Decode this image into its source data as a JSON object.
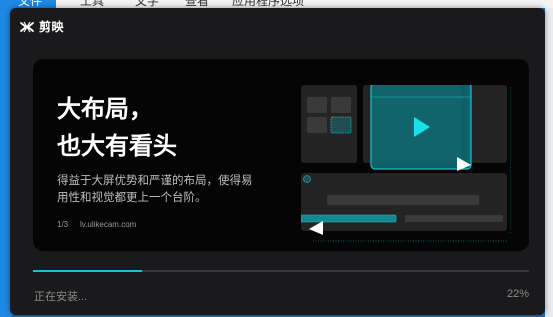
{
  "background_menu": {
    "items": [
      "文件",
      "工具",
      "文字",
      "查看",
      "应用程序选项"
    ]
  },
  "installer": {
    "brand_name": "剪映",
    "promo": {
      "title_line1": "大布局，",
      "title_line2": "也大有看头",
      "description": "得益于大屏优势和严谨的布局，使得易用性和视觉都更上一个台阶。",
      "page_indicator": "1/3",
      "url": "lv.ulikecam.com"
    },
    "progress": {
      "value": 0.22,
      "status_text": "正在安装...",
      "percent_text": "22%"
    },
    "colors": {
      "accent": "#12c4d6",
      "panel_bg": "#1a1a1c",
      "promo_bg": "#050505"
    }
  }
}
